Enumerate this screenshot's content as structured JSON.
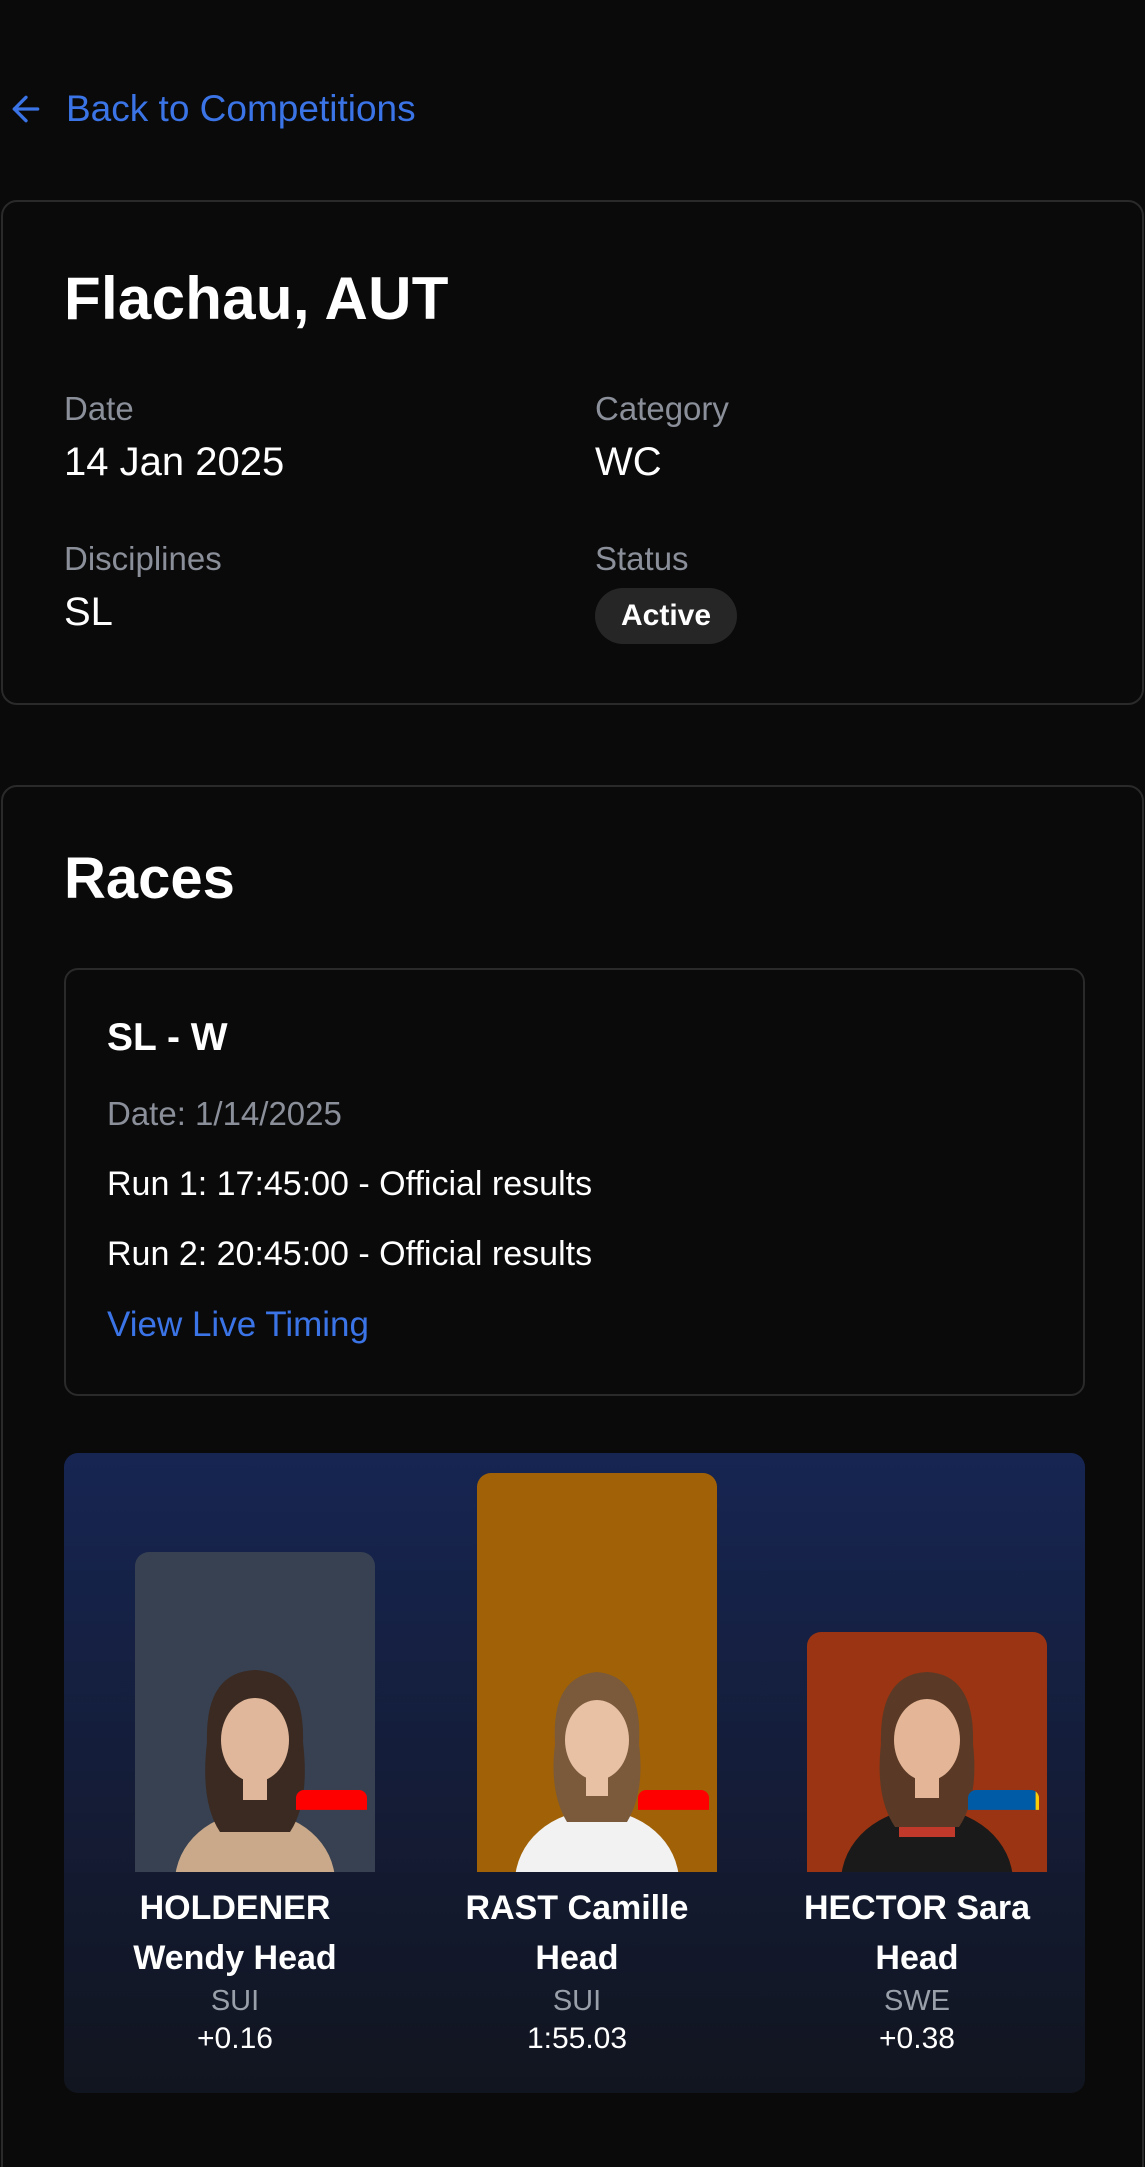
{
  "nav": {
    "back_label": "Back to Competitions"
  },
  "competition": {
    "title": "Flachau, AUT",
    "date_label": "Date",
    "date_value": "14 Jan 2025",
    "category_label": "Category",
    "category_value": "WC",
    "disciplines_label": "Disciplines",
    "disciplines_value": "SL",
    "status_label": "Status",
    "status_value": "Active"
  },
  "races": {
    "heading": "Races",
    "items": [
      {
        "title": "SL - W",
        "date": "Date: 1/14/2025",
        "run1": "Run 1: 17:45:00 - Official results",
        "run2": "Run 2: 20:45:00 - Official results",
        "live_link": "View Live Timing"
      }
    ]
  },
  "podium": {
    "athletes": [
      {
        "place": 2,
        "name": "HOLDENER Wendy Head",
        "country": "SUI",
        "time": "+0.16",
        "card_color": "#374151",
        "flag": "swiss-flag-icon"
      },
      {
        "place": 1,
        "name": "RAST Camille Head",
        "country": "SUI",
        "time": "1:55.03",
        "card_color": "#a16207",
        "flag": "swiss-flag-icon"
      },
      {
        "place": 3,
        "name": "HECTOR Sara Head",
        "country": "SWE",
        "time": "+0.38",
        "card_color": "#9a3412",
        "flag": "swedish-flag-icon"
      }
    ]
  },
  "colors": {
    "accent": "#3b74e6",
    "background": "#0a0a0a",
    "border": "#2a2a2a"
  }
}
